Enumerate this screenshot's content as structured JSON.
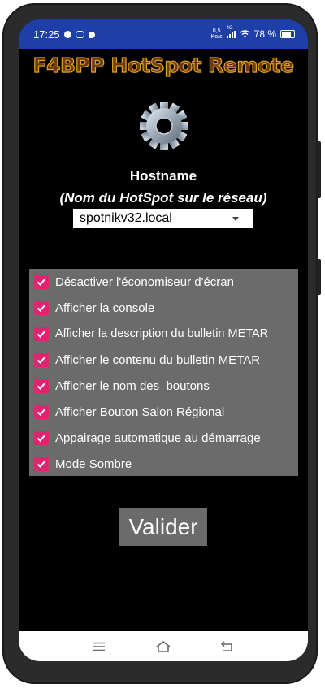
{
  "status_bar": {
    "time": "17:25",
    "speed_value": "0,5",
    "speed_unit": "Ko/s",
    "network": "4G",
    "battery": "78 %"
  },
  "app": {
    "title": "F4BPP HotSpot Remote"
  },
  "hostname": {
    "label": "Hostname",
    "sublabel": "(Nom du HotSpot sur le réseau)",
    "selected": "spotnikv32.local"
  },
  "options": [
    {
      "label": "Désactiver l'économiseur d'écran",
      "checked": true
    },
    {
      "label": "Afficher la console",
      "checked": true
    },
    {
      "label": "Afficher la description du bulletin METAR",
      "checked": true
    },
    {
      "label": "Afficher le contenu du bulletin METAR",
      "checked": true
    },
    {
      "label": "Afficher le nom des  boutons",
      "checked": true
    },
    {
      "label": "Afficher Bouton Salon Régional",
      "checked": true
    },
    {
      "label": "Appairage automatique au démarrage",
      "checked": true
    },
    {
      "label": "Mode Sombre",
      "checked": true
    }
  ],
  "submit_label": "Valider",
  "icons": {
    "settings": "gear-icon",
    "nav_menu": "menu-icon",
    "nav_home": "home-icon",
    "nav_back": "back-icon"
  },
  "colors": {
    "status_bar": "#1f3fa8",
    "checkbox": "#e0246f",
    "panel": "#6b6b6b",
    "background": "#000000"
  }
}
